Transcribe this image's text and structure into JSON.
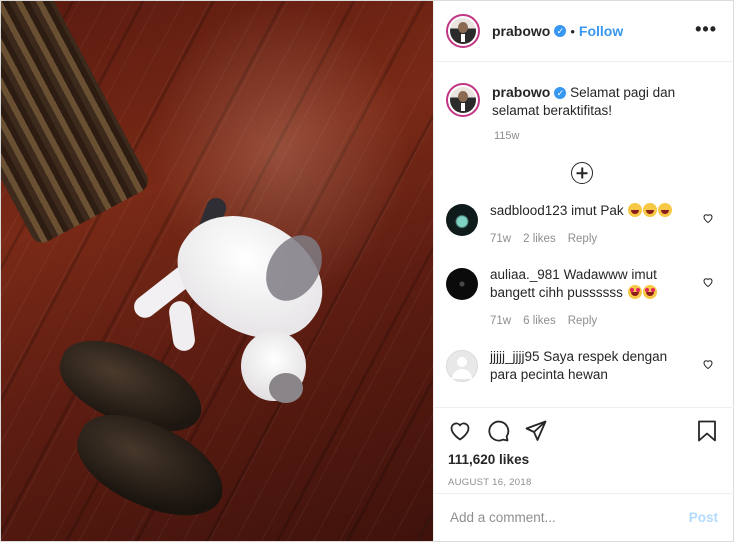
{
  "header": {
    "username": "prabowo",
    "separator": "•",
    "follow_label": "Follow",
    "more_label": "•••"
  },
  "caption": {
    "username": "prabowo",
    "text": "Selamat pagi dan selamat beraktifitas!",
    "time": "115w"
  },
  "comments": [
    {
      "username": "sadblood123",
      "text": "imut Pak",
      "emojis": [
        "grinning-squinting-face",
        "grinning-squinting-face",
        "grinning-squinting-face"
      ],
      "time": "71w",
      "likes": "2 likes",
      "reply": "Reply"
    },
    {
      "username": "auliaa._981",
      "text": "Wadawww imut bangett cihh pussssss",
      "emojis": [
        "heart-eyes-face",
        "heart-eyes-face"
      ],
      "time": "71w",
      "likes": "6 likes",
      "reply": "Reply"
    },
    {
      "username": "jjjjj_jjjj95",
      "text": "Saya respek dengan para pecinta hewan"
    }
  ],
  "actions": {
    "like_icon": "heart-outline-icon",
    "comment_icon": "comment-bubble-icon",
    "share_icon": "paper-plane-icon",
    "save_icon": "bookmark-icon",
    "likes_count": "111,620 likes",
    "date": "AUGUST 16, 2018"
  },
  "add_comment": {
    "placeholder": "Add a comment...",
    "post_label": "Post"
  },
  "colors": {
    "accent": "#3897f0",
    "post_disabled": "#b3dbff",
    "muted": "#8e8e8e"
  }
}
